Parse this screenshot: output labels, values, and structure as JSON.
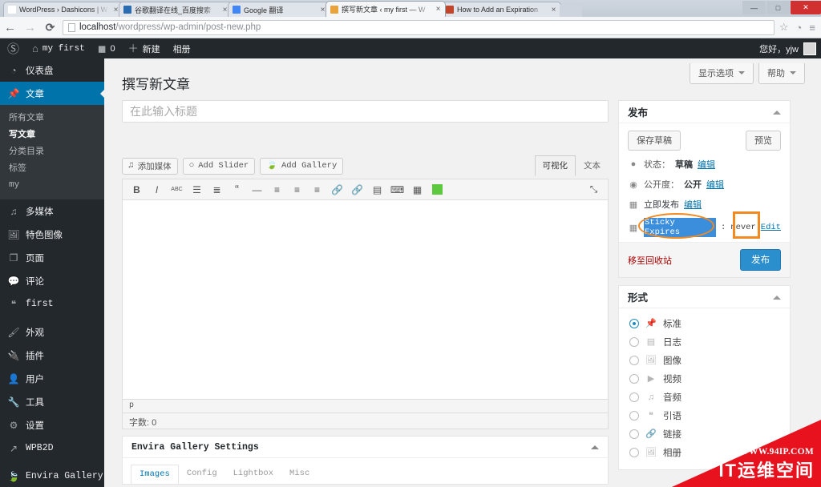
{
  "browser": {
    "tabs": [
      {
        "title": "WordPress › Dashicons | W",
        "favicon": "#ffffff",
        "active": false,
        "close": "×"
      },
      {
        "title": "谷歌翻译在线_百度搜索",
        "favicon": "#2b6cb0",
        "active": false,
        "close": "×"
      },
      {
        "title": "Google 翻译",
        "favicon": "#4285f4",
        "active": false,
        "close": "×"
      },
      {
        "title": "撰写新文章 ‹ my first — W",
        "favicon": "#e8a33d",
        "active": true,
        "close": "×"
      },
      {
        "title": "How to Add an Expiration",
        "favicon": "#c0452a",
        "active": false,
        "close": "×"
      }
    ],
    "nav": {
      "back_icon": "←",
      "forward_icon": "→",
      "reload_icon": "⟳",
      "star_icon": "☆",
      "extension_icon": "◔",
      "menu_icon": "≡"
    },
    "url_host": "localhost",
    "url_path": "/wordpress/wp-admin/post-new.php",
    "window_buttons": {
      "minimize": "—",
      "maximize": "□",
      "close": "✕"
    },
    "newtab_label": ""
  },
  "adminbar": {
    "logo_icon": "wordpress-logo-icon",
    "site_icon": "⌂",
    "site_name": "my first",
    "comment_icon": "💬",
    "comment_count": "0",
    "new_icon": "＋",
    "new_label": "新建",
    "album_label": "相册",
    "greeting": "您好，yjw"
  },
  "sidebar": {
    "items": [
      {
        "label": "仪表盘",
        "icon": "◔",
        "current": false,
        "mono": false
      },
      {
        "label": "文章",
        "icon": "📌",
        "current": true,
        "mono": false
      },
      {
        "label": "多媒体",
        "icon": "♫",
        "current": false,
        "mono": false
      },
      {
        "label": "特色图像",
        "icon": "🖼",
        "current": false,
        "mono": false
      },
      {
        "label": "页面",
        "icon": "❐",
        "current": false,
        "mono": false
      },
      {
        "label": "评论",
        "icon": "💬",
        "current": false,
        "mono": false
      },
      {
        "label": "first",
        "icon": "❝",
        "current": false,
        "mono": true
      },
      {
        "label": "外观",
        "icon": "🖌",
        "current": false,
        "mono": false
      },
      {
        "label": "插件",
        "icon": "🔌",
        "current": false,
        "mono": false
      },
      {
        "label": "用户",
        "icon": "👤",
        "current": false,
        "mono": false
      },
      {
        "label": "工具",
        "icon": "🔧",
        "current": false,
        "mono": false
      },
      {
        "label": "设置",
        "icon": "⚙",
        "current": false,
        "mono": false
      },
      {
        "label": "WPB2D",
        "icon": "↗",
        "current": false,
        "mono": true
      },
      {
        "label": "Envira Gallery",
        "icon": "🍃",
        "current": false,
        "mono": true
      }
    ],
    "submenu": [
      {
        "label": "所有文章",
        "current": false,
        "mono": false
      },
      {
        "label": "写文章",
        "current": true,
        "mono": false
      },
      {
        "label": "分类目录",
        "current": false,
        "mono": false
      },
      {
        "label": "标签",
        "current": false,
        "mono": false
      },
      {
        "label": "my",
        "current": false,
        "mono": true
      }
    ]
  },
  "screen_meta": {
    "screen_options": "显示选项",
    "help": "帮助"
  },
  "main": {
    "page_title": "撰写新文章",
    "title_placeholder": "在此输入标题",
    "title_value": "",
    "media_buttons": [
      {
        "label": "添加媒体",
        "icon": "♫"
      },
      {
        "label": "Add Slider",
        "icon": "○"
      },
      {
        "label": "Add Gallery",
        "icon": "🍃"
      }
    ],
    "editor_tabs": [
      {
        "label": "可视化",
        "active": true
      },
      {
        "label": "文本",
        "active": false
      }
    ],
    "toolbar_buttons": [
      {
        "name": "bold-icon",
        "glyph": "B"
      },
      {
        "name": "italic-icon",
        "glyph": "I"
      },
      {
        "name": "strikethrough-icon",
        "glyph": "ABC"
      },
      {
        "name": "unordered-list-icon",
        "glyph": "☰"
      },
      {
        "name": "ordered-list-icon",
        "glyph": "≣"
      },
      {
        "name": "blockquote-icon",
        "glyph": "“"
      },
      {
        "name": "horizontal-rule-icon",
        "glyph": "—"
      },
      {
        "name": "align-left-icon",
        "glyph": "≡"
      },
      {
        "name": "align-center-icon",
        "glyph": "≡"
      },
      {
        "name": "align-right-icon",
        "glyph": "≡"
      },
      {
        "name": "insert-link-icon",
        "glyph": "🔗"
      },
      {
        "name": "unlink-icon",
        "glyph": "🔗"
      },
      {
        "name": "read-more-icon",
        "glyph": "▤"
      },
      {
        "name": "keyboard-shortcuts-icon",
        "glyph": "⌨"
      },
      {
        "name": "toolbar-toggle-icon",
        "glyph": "▦"
      },
      {
        "name": "text-color-icon",
        "glyph": ""
      }
    ],
    "toolbar_accent_color": "#5cc93f",
    "fullscreen_icon": "⤡",
    "editor_path": "p",
    "word_count_label": "字数:",
    "word_count_value": "0",
    "envira": {
      "title": "Envira Gallery Settings",
      "tabs": [
        {
          "label": "Images",
          "active": true
        },
        {
          "label": "Config",
          "active": false
        },
        {
          "label": "Lightbox",
          "active": false
        },
        {
          "label": "Misc",
          "active": false
        }
      ]
    }
  },
  "publish_panel": {
    "title": "发布",
    "save_draft": "保存草稿",
    "preview": "预览",
    "status_icon": "📍",
    "status_label": "状态：",
    "status_value": "草稿",
    "status_edit": "编辑",
    "visibility_icon": "👁",
    "visibility_label": "公开度：",
    "visibility_value": "公开",
    "visibility_edit": "编辑",
    "publish_icon": "📅",
    "publish_when": "立即发布",
    "publish_edit": "编辑",
    "sticky_icon": "📅",
    "sticky_label": "Sticky Expires",
    "sticky_colon": ":",
    "sticky_value": "never",
    "sticky_edit": "Edit",
    "trash": "移至回收站",
    "publish_button": "发布",
    "publish_button_color": "#2b8fce",
    "annotation_color": "#f08a21"
  },
  "format_panel": {
    "title": "形式",
    "options": [
      {
        "label": "标准",
        "icon": "📌",
        "checked": true
      },
      {
        "label": "日志",
        "icon": "▤",
        "checked": false
      },
      {
        "label": "图像",
        "icon": "🖼",
        "checked": false
      },
      {
        "label": "视频",
        "icon": "▶",
        "checked": false
      },
      {
        "label": "音频",
        "icon": "♫",
        "checked": false
      },
      {
        "label": "引语",
        "icon": "❝",
        "checked": false
      },
      {
        "label": "链接",
        "icon": "🔗",
        "checked": false
      },
      {
        "label": "相册",
        "icon": "🖼",
        "checked": false
      }
    ]
  },
  "watermark": {
    "url": "WWW.94IP.COM",
    "text": "IT运维空间",
    "color": "#e8121f"
  }
}
